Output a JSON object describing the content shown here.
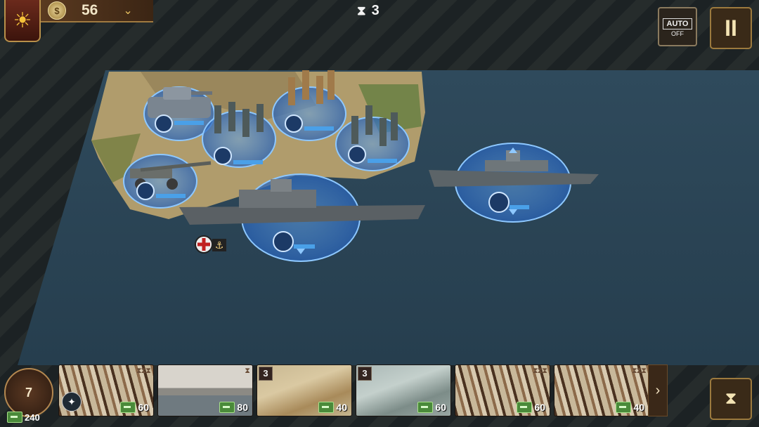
{
  "hud": {
    "coins": "56",
    "turns": "3",
    "auto_label": "AUTO",
    "auto_state": "OFF"
  },
  "icons": {
    "weather": "sun-icon",
    "coin": "coin-icon",
    "dropdown": "chevron-down-icon",
    "turns": "hourglass-icon",
    "auto": "crossed-rifles-icon",
    "pause": "pause-icon",
    "end_turn": "hourglass-icon",
    "next_cards": "chevron-right-icon"
  },
  "deck": {
    "count": "7",
    "supply": "240"
  },
  "cards": [
    {
      "type": "infantry",
      "level": "",
      "cost": "60"
    },
    {
      "type": "battleship",
      "level": "",
      "cost": "80"
    },
    {
      "type": "fighter",
      "level": "3",
      "cost": "40"
    },
    {
      "type": "fighter",
      "level": "3",
      "cost": "60"
    },
    {
      "type": "infantry",
      "level": "",
      "cost": "60"
    },
    {
      "type": "infantry",
      "level": "",
      "cost": "40"
    }
  ],
  "colors": {
    "sea": "#2c4658",
    "land": "#a89a6a",
    "unit_ring": "#3a7ac8",
    "frame": "#9c7a3e"
  }
}
